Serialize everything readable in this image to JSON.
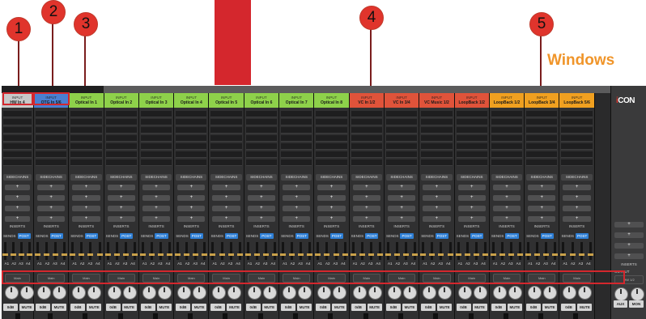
{
  "callouts": [
    "1",
    "2",
    "3",
    "4",
    "5"
  ],
  "platform_label": "Windows",
  "mixer": {
    "channels": [
      {
        "type": "INPUT",
        "name": "HW In 4",
        "color": "#c8c8c8"
      },
      {
        "type": "INPUT",
        "name": "OTG In 5/6",
        "color": "#4a7fd1"
      },
      {
        "type": "INPUT",
        "name": "Optical In 1",
        "color": "#8ed14a"
      },
      {
        "type": "INPUT",
        "name": "Optical In 2",
        "color": "#8ed14a"
      },
      {
        "type": "INPUT",
        "name": "Optical In 3",
        "color": "#8ed14a"
      },
      {
        "type": "INPUT",
        "name": "Optical In 4",
        "color": "#8ed14a"
      },
      {
        "type": "INPUT",
        "name": "Optical In 5",
        "color": "#8ed14a"
      },
      {
        "type": "INPUT",
        "name": "Optical In 6",
        "color": "#8ed14a"
      },
      {
        "type": "INPUT",
        "name": "Optical In 7",
        "color": "#8ed14a"
      },
      {
        "type": "INPUT",
        "name": "Optical In 8",
        "color": "#8ed14a"
      },
      {
        "type": "INPUT",
        "name": "VC In 1/2",
        "color": "#e0533a"
      },
      {
        "type": "INPUT",
        "name": "VC In 3/4",
        "color": "#e0533a"
      },
      {
        "type": "INPUT",
        "name": "VC Music 1/2",
        "color": "#e0533a"
      },
      {
        "type": "INPUT",
        "name": "LoopBack 1/2",
        "color": "#e0533a"
      },
      {
        "type": "INPUT",
        "name": "LoopBack 1/2",
        "color": "#f0a020"
      },
      {
        "type": "INPUT",
        "name": "LoopBack 3/4",
        "color": "#f0a020"
      },
      {
        "type": "INPUT",
        "name": "LoopBack 5/6",
        "color": "#f0a020"
      }
    ],
    "sidechains_label": "SIDECHAINS",
    "slot_symbol": "+",
    "inserts_label": "INSERTS",
    "sends_label": "SENDS",
    "post_label": "POST",
    "aux_labels": [
      "A1",
      "A2",
      "A3",
      "A4"
    ],
    "output_select_label": "Main",
    "gain_label": "0dB",
    "mute_label": "MUTE",
    "master": {
      "logo_i": "i",
      "logo_text": "CON",
      "inserts_label": "INSERTS",
      "output_label": "OUTPUT",
      "output_value": "HW 1/2",
      "aux_label": "AUX",
      "mon_label": "MON"
    }
  }
}
